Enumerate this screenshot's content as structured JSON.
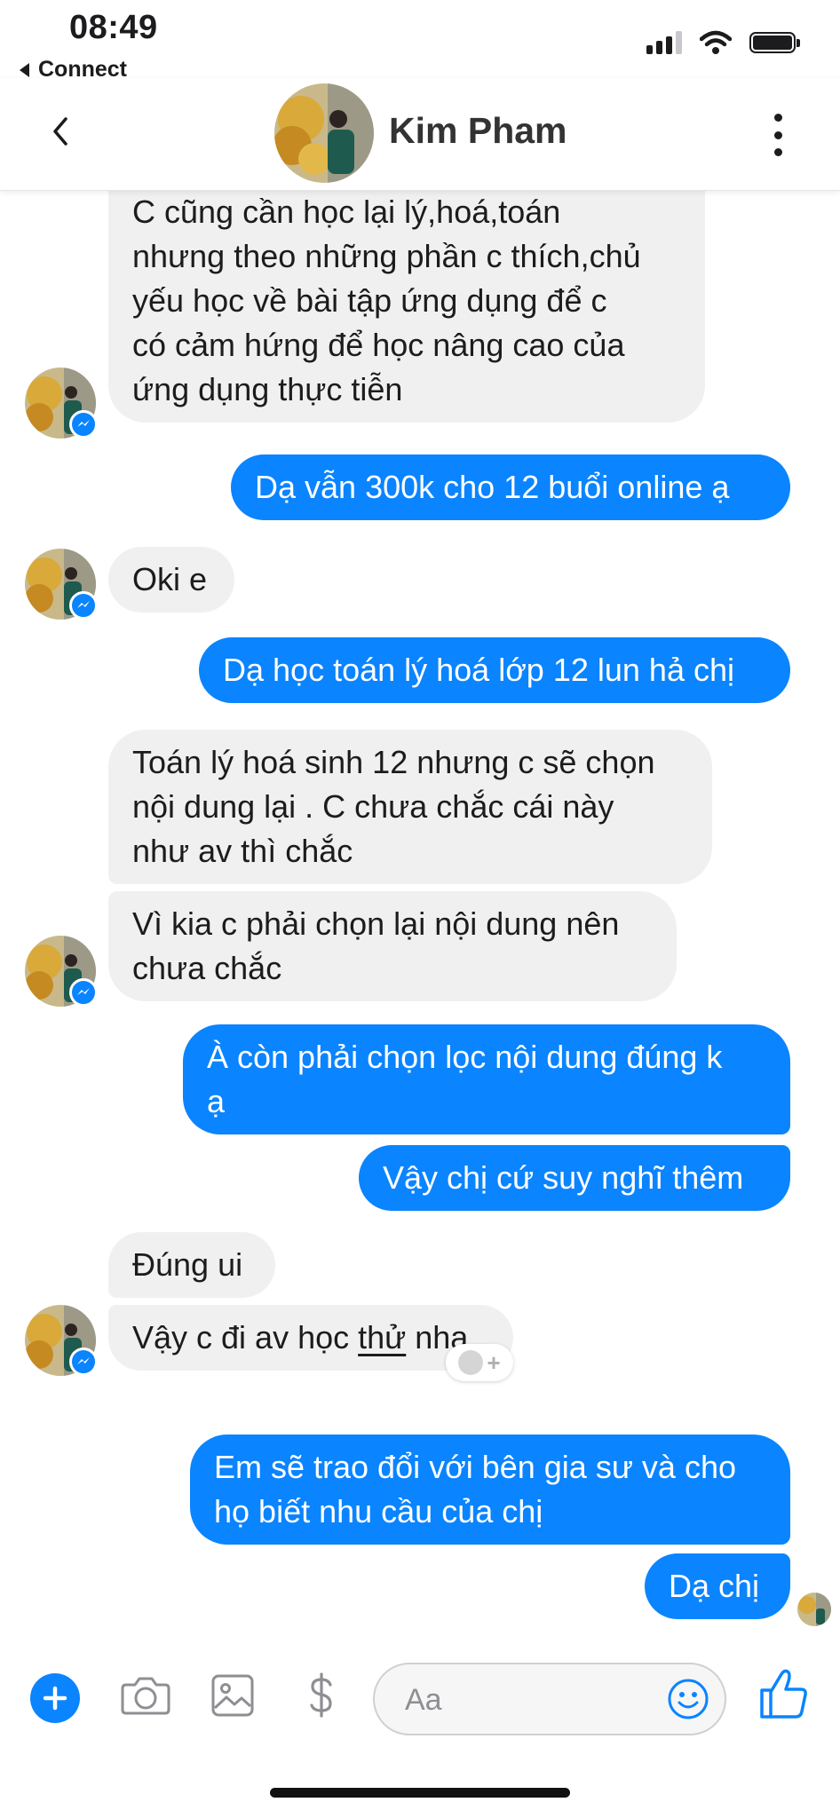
{
  "status_bar": {
    "time": "08:49",
    "back_app": "Connect"
  },
  "header": {
    "contact_name": "Kim Pham"
  },
  "colors": {
    "accent": "#0a84ff",
    "incoming_bubble": "#f0f0f0",
    "badge": "#0a84ff"
  },
  "messages": [
    {
      "from": "them",
      "lines": [
        "C cũng cần học lại lý,hoá,toán",
        "nhưng theo những phần c thích,chủ",
        "yếu học về bài tập ứng dụng để c",
        "có cảm hứng để học nâng cao của",
        "ứng dụng thực tiễn"
      ]
    },
    {
      "from": "me",
      "lines": [
        "Dạ vẫn 300k cho 12 buổi online ạ"
      ]
    },
    {
      "from": "them",
      "lines": [
        "Oki e"
      ]
    },
    {
      "from": "me",
      "lines": [
        "Dạ học toán lý hoá lớp 12 lun hả chị"
      ]
    },
    {
      "from": "them",
      "lines": [
        "Toán lý hoá sinh 12 nhưng c sẽ chọn",
        "nội dung lại . C chưa chắc cái này",
        "như av thì chắc"
      ]
    },
    {
      "from": "them",
      "lines": [
        "Vì kia c phải chọn lại nội dung nên",
        "chưa chắc"
      ]
    },
    {
      "from": "me",
      "lines": [
        "À còn phải chọn lọc nội dung đúng k",
        "ạ"
      ]
    },
    {
      "from": "me",
      "lines": [
        "Vậy chị cứ suy nghĩ thêm"
      ]
    },
    {
      "from": "them",
      "lines": [
        "Đúng ui"
      ]
    },
    {
      "from": "them",
      "before": "Vậy c đi av học ",
      "underlined": "thử",
      "after": " nha"
    },
    {
      "from": "me",
      "lines": [
        "Em sẽ trao đổi với bên gia sư và cho",
        "họ biết nhu cầu của chị"
      ]
    },
    {
      "from": "me",
      "lines": [
        "Dạ chị"
      ]
    }
  ],
  "composer": {
    "placeholder": "Aa",
    "value": ""
  },
  "icons": [
    "chevron-left-icon",
    "more-vertical-icon",
    "messenger-badge-icon",
    "add-reaction-icon",
    "plus-icon",
    "camera-icon",
    "image-icon",
    "dollar-icon",
    "emoji-icon",
    "thumbs-up-icon"
  ]
}
